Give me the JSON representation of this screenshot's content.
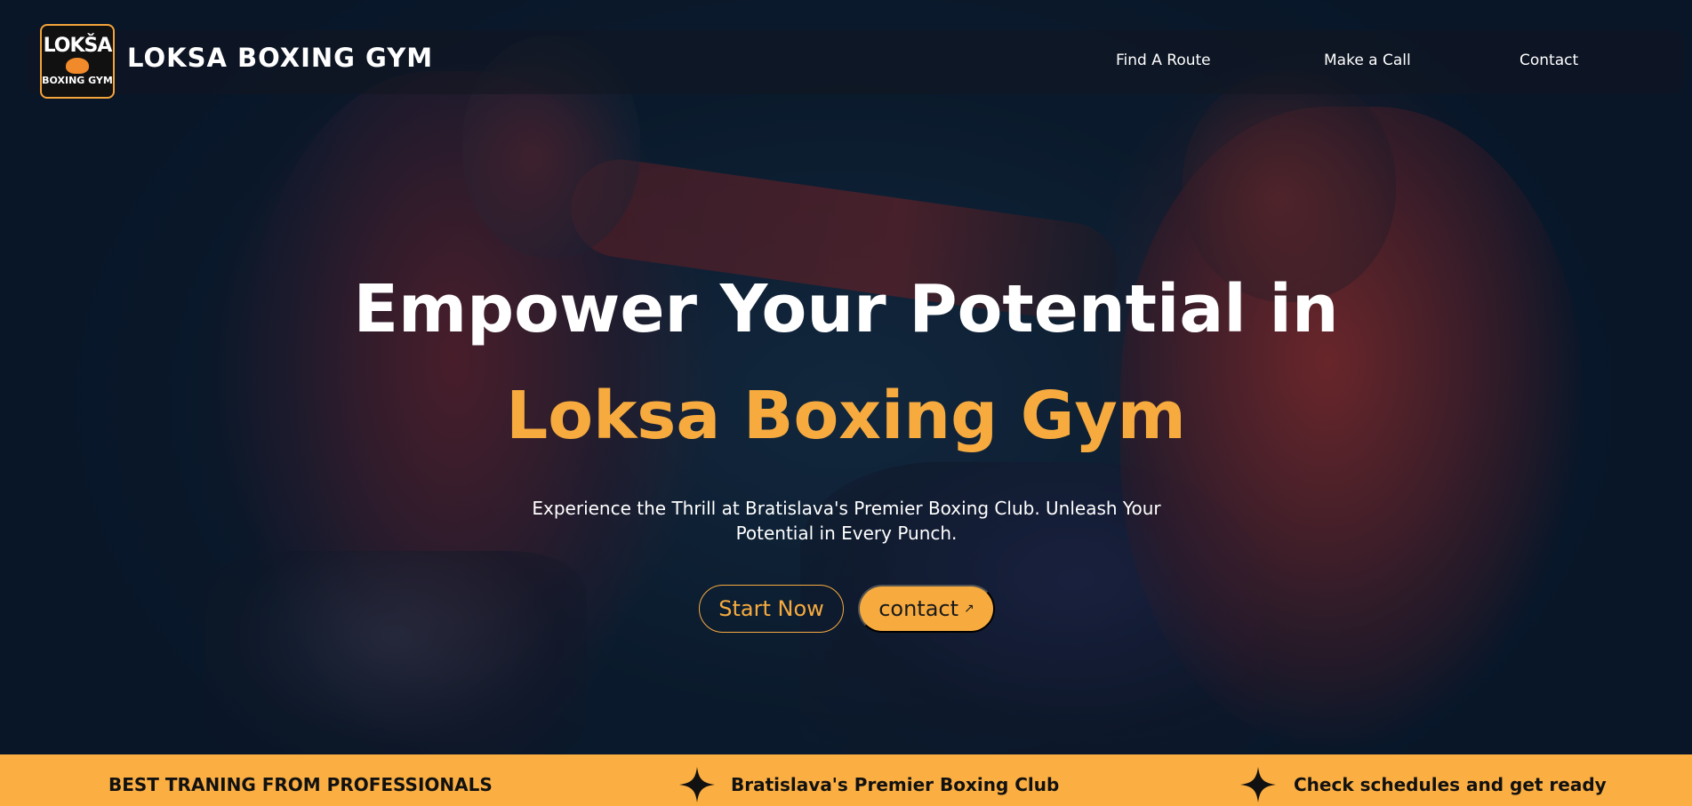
{
  "brand": {
    "logo_top": "LOKŠA",
    "logo_bottom": "BOXING GYM",
    "name": "LOKSA BOXING GYM"
  },
  "nav": {
    "items": [
      {
        "label": "Find A Route"
      },
      {
        "label": "Make a Call"
      },
      {
        "label": "Contact"
      }
    ]
  },
  "hero": {
    "headline": "Empower Your Potential in",
    "headline_accent": "Loksa Boxing Gym",
    "subtext": "Experience the Thrill at Bratislava's Premier Boxing Club. Unleash Your Potential in Every Punch.",
    "start_button": "Start Now",
    "contact_button": "contact",
    "contact_icon": "↗"
  },
  "strip": {
    "items": [
      {
        "label": "BEST TRANING FROM PROFESSIONALS"
      },
      {
        "label": "Bratislava's Premier Boxing Club"
      },
      {
        "label": "Check schedules and get ready"
      }
    ]
  },
  "colors": {
    "accent": "#f7ab3f",
    "strip": "#fbae42",
    "background": "#0b1a2b"
  }
}
